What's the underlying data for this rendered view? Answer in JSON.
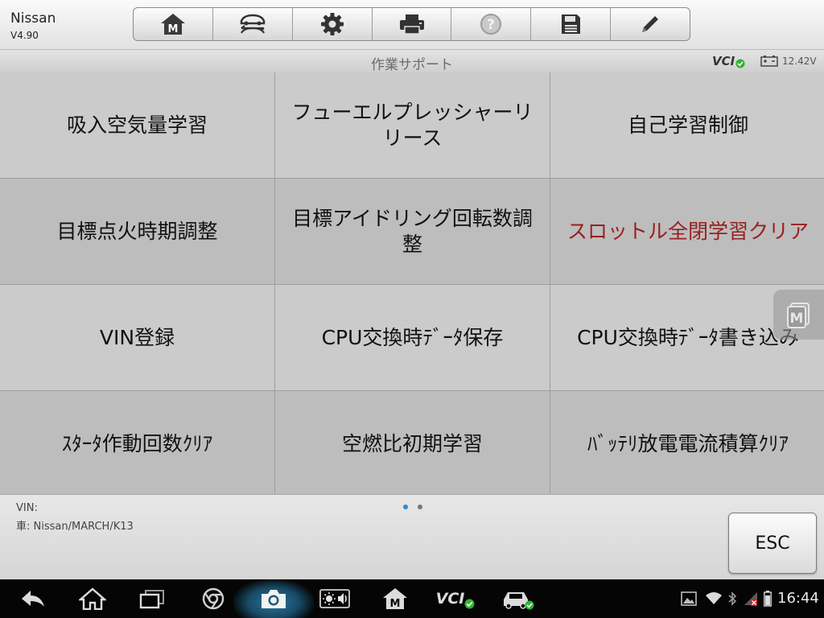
{
  "header": {
    "app_title": "Nissan",
    "version": "V4.90",
    "toolbar": [
      {
        "name": "home-button",
        "icon": "home-m-icon"
      },
      {
        "name": "vehicle-swap-button",
        "icon": "vehicle-swap-icon"
      },
      {
        "name": "settings-button",
        "icon": "gear-icon"
      },
      {
        "name": "print-button",
        "icon": "printer-icon"
      },
      {
        "name": "help-button",
        "icon": "help-icon"
      },
      {
        "name": "save-button",
        "icon": "floppy-disk-icon"
      },
      {
        "name": "edit-button",
        "icon": "pencil-icon"
      }
    ]
  },
  "subheader": {
    "title": "作業サポート",
    "vci_label": "VCI",
    "battery_voltage": "12.42V"
  },
  "grid": {
    "items": [
      {
        "label": "吸入空気量学習"
      },
      {
        "label": "フューエルプレッシャーリリース"
      },
      {
        "label": "自己学習制御"
      },
      {
        "label": "目標点火時期調整"
      },
      {
        "label": "目標アイドリング回転数調整"
      },
      {
        "label": "スロットル全閉学習クリア"
      },
      {
        "label": "VIN登録"
      },
      {
        "label": "CPU交換時ﾃﾞｰﾀ保存"
      },
      {
        "label": "CPU交換時ﾃﾞｰﾀ書き込み"
      },
      {
        "label": "ｽﾀｰﾀ作動回数ｸﾘｱ"
      },
      {
        "label": "空燃比初期学習"
      },
      {
        "label": "ﾊﾞｯﾃﾘ放電電流積算ｸﾘｱ"
      }
    ]
  },
  "footer": {
    "vin_label": "VIN:",
    "vehicle_label": "車: Nissan/MARCH/K13",
    "esc_label": "ESC",
    "page_count": 2,
    "active_page": 1
  },
  "system_bar": {
    "vci_label": "VCI",
    "time": "16:44"
  },
  "colors": {
    "highlight_text": "#9a1e1e",
    "active_dot": "#2d8ad8",
    "status_green": "#2fb52f"
  }
}
